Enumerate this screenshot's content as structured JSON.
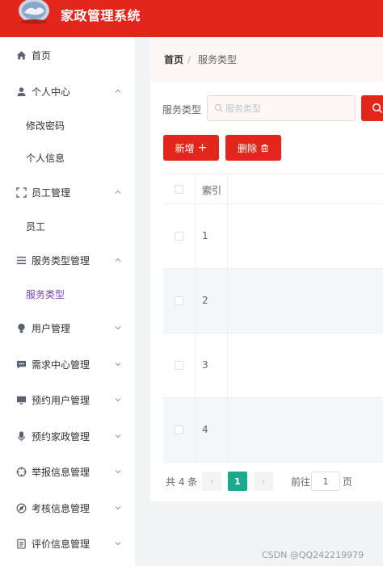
{
  "app": {
    "title": "家政管理系统"
  },
  "sidebar": {
    "items": [
      {
        "label": "首页",
        "icon": "home-icon"
      },
      {
        "label": "个人中心",
        "icon": "user-icon",
        "expanded": true
      },
      {
        "label": "修改密码",
        "sub": true
      },
      {
        "label": "个人信息",
        "sub": true
      },
      {
        "label": "员工管理",
        "icon": "fullscreen-icon",
        "expanded": true
      },
      {
        "label": "员工",
        "sub": true
      },
      {
        "label": "服务类型管理",
        "icon": "list-icon",
        "expanded": true
      },
      {
        "label": "服务类型",
        "sub": true,
        "active": true
      },
      {
        "label": "用户管理",
        "icon": "bulb-icon"
      },
      {
        "label": "需求中心管理",
        "icon": "chat-icon"
      },
      {
        "label": "预约用户管理",
        "icon": "monitor-icon"
      },
      {
        "label": "预约家政管理",
        "icon": "microphone-icon"
      },
      {
        "label": "举报信息管理",
        "icon": "crosshair-icon"
      },
      {
        "label": "考核信息管理",
        "icon": "compass-icon"
      },
      {
        "label": "评价信息管理",
        "icon": "document-icon"
      }
    ]
  },
  "breadcrumb": {
    "home": "首页",
    "separator": "/",
    "current": "服务类型"
  },
  "search": {
    "label": "服务类型",
    "placeholder": "服务类型",
    "value": ""
  },
  "actions": {
    "add": "新增",
    "add_glyph": "+",
    "delete": "删除"
  },
  "table": {
    "headers": {
      "index": "索引"
    },
    "rows": [
      {
        "index": "1"
      },
      {
        "index": "2"
      },
      {
        "index": "3"
      },
      {
        "index": "4"
      }
    ]
  },
  "pagination": {
    "total": "共 4 条",
    "prev": "‹",
    "current": "1",
    "next": "›",
    "goto": "前往",
    "goto_value": "1",
    "page_suffix": "页"
  },
  "watermark": "CSDN @QQ242219979",
  "colors": {
    "brand": "#e3261b",
    "active_menu": "#7b3fb5",
    "pager_active": "#1aaa8c"
  }
}
